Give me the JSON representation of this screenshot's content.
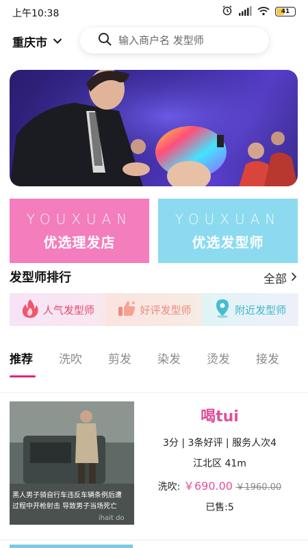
{
  "status": {
    "time": "上午10:38",
    "battery": "41"
  },
  "header": {
    "city": "重庆市",
    "search_placeholder": "输入商户名 发型师"
  },
  "promos": [
    {
      "en": "YOUXUAN",
      "cn": "优选理发店",
      "color": "#f37dbd"
    },
    {
      "en": "YOUXUAN",
      "cn": "优选发型师",
      "color": "#8bdaf0"
    }
  ],
  "ranking": {
    "title": "发型师排行",
    "all_label": "全部",
    "categories": [
      {
        "label": "人气发型师",
        "icon": "flame-icon",
        "color": "#e8476e"
      },
      {
        "label": "好评发型师",
        "icon": "thumbs-up-icon",
        "color": "#ef8a7c"
      },
      {
        "label": "附近发型师",
        "icon": "location-pin-icon",
        "color": "#3eb6c8"
      }
    ]
  },
  "tabs": [
    "推荐",
    "洗吹",
    "剪发",
    "染发",
    "烫发",
    "接发"
  ],
  "shop": {
    "name": "喝tui",
    "meta": "3分 | 3条好评 | 服务人次4",
    "location": "江北区 41m",
    "service": "洗吹:",
    "price": "￥690.00",
    "old_price": "￥1960.00",
    "sold": "已售:5",
    "img_caption_1": "黑人男子骑自行车违反车辆条例后遭",
    "img_caption_2": "过程中开枪射击 导致男子当场死亡",
    "img_watermark": "ihait do"
  },
  "colors": {
    "accent": "#e2217a",
    "pink": "#e14f99"
  }
}
